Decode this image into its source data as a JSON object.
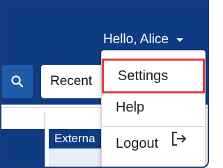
{
  "header": {
    "greeting": "Hello, Alice",
    "greeting_caret_icon": "chevron-down-icon"
  },
  "search": {
    "button_icon": "search-icon",
    "recent_value": "Recent"
  },
  "table": {
    "column_header": "Externa"
  },
  "user_menu": {
    "items": [
      {
        "label": "Settings",
        "highlighted": true
      },
      {
        "label": "Help"
      },
      {
        "label": "Logout",
        "icon": "logout-icon"
      }
    ],
    "highlight_color": "#e23b3b"
  },
  "colors": {
    "brand_navy": "#0f3b83",
    "search_button": "#1f5aa8"
  }
}
